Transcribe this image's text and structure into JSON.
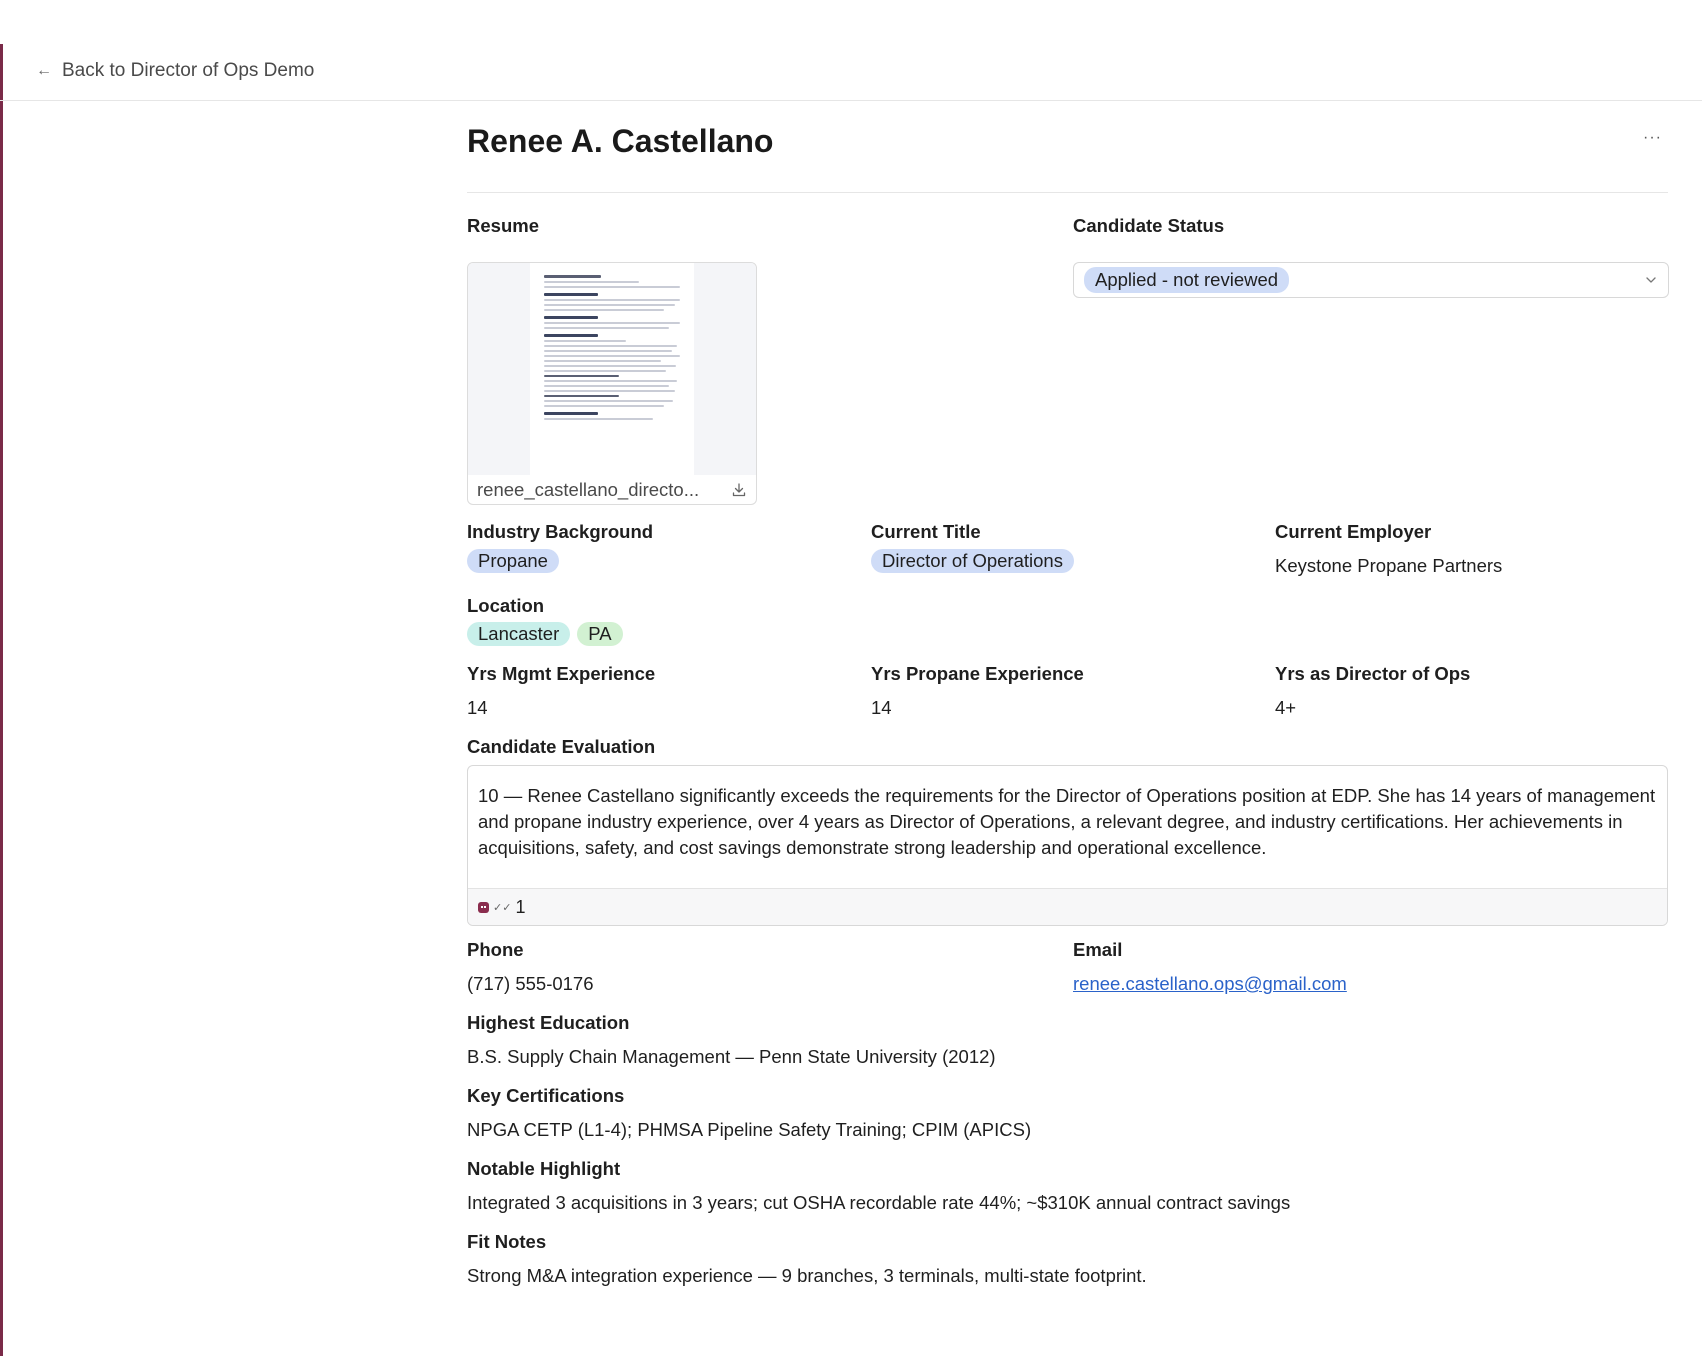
{
  "nav": {
    "back_label": "Back to Director of Ops Demo"
  },
  "header": {
    "title": "Renee A. Castellano",
    "more_label": "···"
  },
  "resume": {
    "label": "Resume",
    "filename": "renee_castellano_directo..."
  },
  "status": {
    "label": "Candidate Status",
    "value": "Applied - not reviewed"
  },
  "fields": {
    "industry": {
      "label": "Industry Background",
      "value": "Propane"
    },
    "title": {
      "label": "Current Title",
      "value": "Director of Operations"
    },
    "employer": {
      "label": "Current Employer",
      "value": "Keystone Propane Partners"
    },
    "location": {
      "label": "Location",
      "city": "Lancaster",
      "state": "PA"
    },
    "mgmt_years": {
      "label": "Yrs Mgmt Experience",
      "value": "14"
    },
    "propane_years": {
      "label": "Yrs Propane Experience",
      "value": "14"
    },
    "director_years": {
      "label": "Yrs as Director of Ops",
      "value": "4+"
    }
  },
  "evaluation": {
    "label": "Candidate Evaluation",
    "text": "10 — Renee Castellano significantly exceeds the requirements for the Director of Operations position at EDP. She has 14 years of management and propane industry experience, over 4 years as Director of Operations, a relevant degree, and industry certifications. Her achievements in acquisitions, safety, and cost savings demonstrate strong leadership and operational excellence.",
    "count": "1"
  },
  "contact": {
    "phone_label": "Phone",
    "phone": "(717) 555-0176",
    "email_label": "Email",
    "email": "renee.castellano.ops@gmail.com"
  },
  "details": {
    "education_label": "Highest Education",
    "education": "B.S. Supply Chain Management — Penn State University (2012)",
    "certs_label": "Key Certifications",
    "certs": "NPGA CETP (L1-4); PHMSA Pipeline Safety Training; CPIM (APICS)",
    "highlight_label": "Notable Highlight",
    "highlight": "Integrated 3 acquisitions in 3 years; cut OSHA recordable rate 44%; ~$310K annual contract savings",
    "fit_label": "Fit Notes",
    "fit": "Strong M&A integration experience — 9 branches, 3 terminals, multi-state footprint."
  },
  "colors": {
    "accent": "#7a2a48",
    "pill_blue": "#cfdcf7",
    "pill_teal": "#c8efea",
    "pill_green": "#d2f1d2",
    "link": "#2a62c9"
  }
}
